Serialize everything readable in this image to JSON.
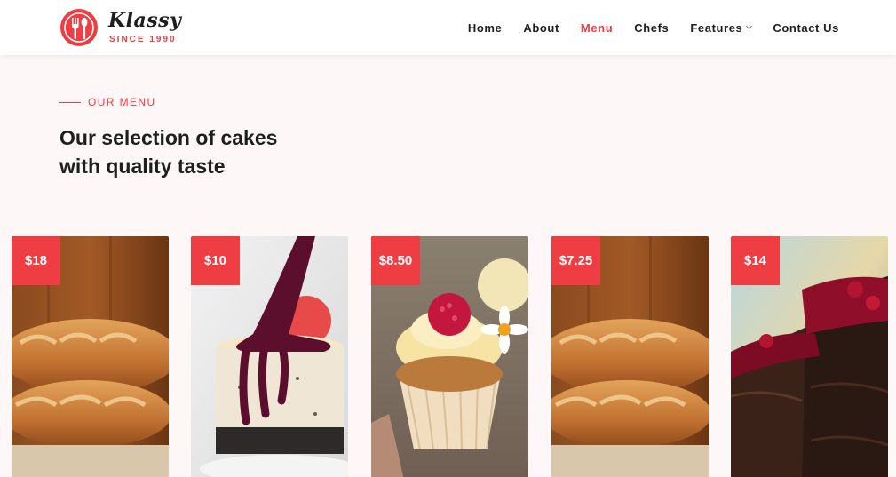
{
  "brand": {
    "name": "Klassy",
    "tagline": "SINCE 1990",
    "accent": "#ee3d43"
  },
  "nav": {
    "items": [
      {
        "label": "Home",
        "active": false
      },
      {
        "label": "About",
        "active": false
      },
      {
        "label": "Menu",
        "active": true
      },
      {
        "label": "Chefs",
        "active": false
      },
      {
        "label": "Features",
        "active": false,
        "dropdown": true
      },
      {
        "label": "Contact Us",
        "active": false
      }
    ]
  },
  "menu_section": {
    "tag": "OUR MENU",
    "title_line1": "Our selection of cakes",
    "title_line2": "with quality taste"
  },
  "cards": [
    {
      "price": "$18",
      "image": "bread-loaves-image"
    },
    {
      "price": "$10",
      "image": "cheesecake-berry-sauce-image"
    },
    {
      "price": "$8.50",
      "image": "cupcake-raspberry-image"
    },
    {
      "price": "$7.25",
      "image": "bread-loaves-image"
    },
    {
      "price": "$14",
      "image": "chocolate-berry-cake-image"
    }
  ]
}
